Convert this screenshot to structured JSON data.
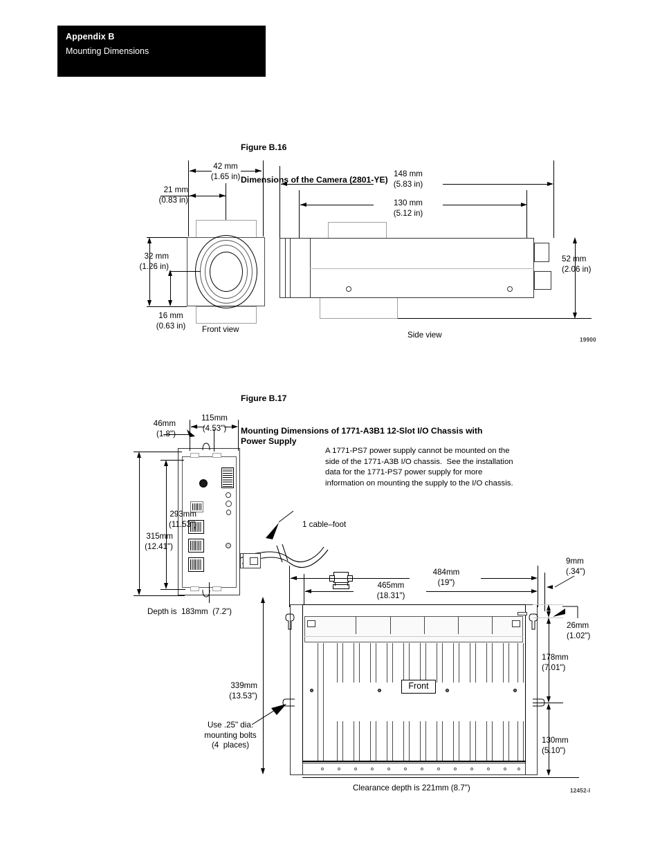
{
  "header": {
    "appendix": "Appendix B",
    "subtitle": "Mounting Dimensions"
  },
  "figure16": {
    "number": "Figure B.16",
    "caption": "Dimensions of the Camera (2801-YE)",
    "drawing_number": "19900",
    "views": {
      "front": "Front view",
      "side": "Side view"
    },
    "dimensions": {
      "width_42": "42 mm\n(1.65 in)",
      "offset_21": "21 mm\n(0.83 in)",
      "length_148": "148 mm\n(5.83 in)",
      "length_130": "130 mm\n(5.12 in)",
      "height_32": "32 mm\n(1.26 in)",
      "height_16": "16 mm\n(0.63 in)",
      "height_52": "52 mm\n(2.06 in)"
    }
  },
  "figure17": {
    "number": "Figure B.17",
    "caption": "Mounting Dimensions of 1771-A3B1 12-Slot I/O Chassis with\nPower Supply",
    "drawing_number": "12452-I",
    "note": "A 1771-PS7 power supply cannot be mounted on the\nside of the 1771-A3B I/O chassis.  See the installation\ndata for the 1771-PS7 power supply for more\ninformation on mounting the supply to the I/O chassis.",
    "labels": {
      "cable_foot": "1 cable–foot",
      "depth": "Depth is  183mm  (7.2\")",
      "bolts": "Use .25\" dia.\nmounting bolts\n(4  places)",
      "clearance": "Clearance depth is 221mm (8.7\")",
      "front": "Front"
    },
    "dimensions": {
      "ps_46": "46mm\n(1.8\")",
      "ps_115": "115mm\n(4.53\")",
      "ps_293": "293mm\n(11.53\")",
      "ps_315": "315mm\n(12.41\")",
      "chassis_465": "465mm\n(18.31\")",
      "chassis_484": "484mm\n(19\")",
      "chassis_9": "9mm\n(.34\")",
      "chassis_26": "26mm\n(1.02\")",
      "chassis_178": "178mm\n(7.01\")",
      "chassis_130": "130mm\n(5.10\")",
      "chassis_339": "339mm\n(13.53\")"
    }
  }
}
